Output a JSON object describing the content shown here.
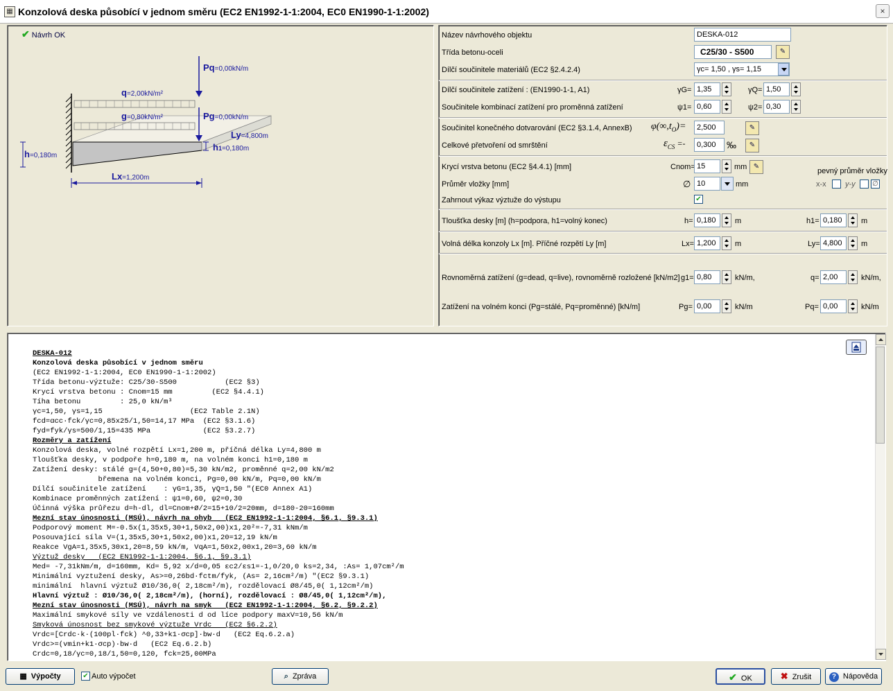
{
  "window": {
    "title": "Konzolová deska působící v jednom směru (EC2 EN1992-1-1:2004, EC0 EN1990-1-1:2002)",
    "close": "×"
  },
  "drawing": {
    "status": "Návrh OK",
    "pq_label": "Pq",
    "pq_value": "=0,00kN/m",
    "q_label": "q",
    "q_value": "=2,00kN/m²",
    "g_label": "g",
    "g_value": "=0,80kN/m²",
    "pg_label": "Pg",
    "pg_value": "=0,00kN/m",
    "ly_label": "Ly",
    "ly_value": "=4,800m",
    "h_label": "h",
    "h_value": "=0,180m",
    "h1_label": "h",
    "h1_sub": "1",
    "h1_value": "=0,180m",
    "lx_label": "Lx",
    "lx_value": "=1,200m"
  },
  "params": {
    "name_label": "Název návrhového objektu",
    "name_value": "DESKA-012",
    "class_label": "Třída betonu-oceli",
    "class_value": "C25/30 - S500",
    "mat_label": "Dílčí součinitele materiálů (EC2 §2.4.2.4)",
    "mat_value": "γc= 1,50 , γs= 1,15",
    "load_label": "Dílčí součinitele zatížení   : (EN1990-1-1, A1)",
    "gG_label": "γG=",
    "gG_value": "1,35",
    "gQ_label": "γQ=",
    "gQ_value": "1,50",
    "comb_label": "Součinitele kombinací zatížení pro proměnná zatížení",
    "psi1_label": "ψ1=",
    "psi1_value": "0,60",
    "psi2_label": "ψ2=",
    "psi2_value": "0,30",
    "creep_label": "Součinitel konečného dotvarování (EC2 §3.1.4, AnnexB)",
    "creep_sym": "φ(∞,t",
    "creep_sym_sub": "O",
    "creep_sym_end": ")=",
    "creep_value": "2,500",
    "shrink_label": "Celkové přetvoření od smrštění",
    "shrink_sym": "ε",
    "shrink_sym_sub": "CS",
    "shrink_sym_end": " =-",
    "shrink_value": "0,300",
    "shrink_unit": "‰",
    "cover_label": "Krycí vrstva betonu (EC2 §4.4.1) [mm]",
    "cnom_label": "Cnom=",
    "cnom_value": "15",
    "cnom_unit": "mm",
    "fixed_diam_label": "pevný průměr vložky",
    "diam_label": "Průměr vložky [mm]",
    "diam_sym": "∅",
    "diam_value": "10",
    "diam_unit": "mm",
    "xx_label": "x-x",
    "yy_label": "y-y",
    "include_label": "Zahrnout výkaz výztuže do výstupu",
    "thick_label": "Tloušťka desky [m] (h=podpora, h1=volný konec)",
    "h_label": "h=",
    "h_value": "0,180",
    "h_unit": "m",
    "h1_label": "h1=",
    "h1_value": "0,180",
    "h1_unit": "m",
    "span_label": "Volná délka konzoly Lx [m].   Příčné rozpětí Ly [m]",
    "lx_label": "Lx=",
    "lx_value": "1,200",
    "lx_unit": "m",
    "ly_label": "Ly=",
    "ly_value": "4,800",
    "ly_unit": "m",
    "udl_label": "Rovnoměrná zatížení (g=dead, q=live), rovnoměrně rozložené [kN/m2]",
    "g1_label": "g1=",
    "g1_value": "0,80",
    "g1_unit": "kN/m,",
    "q_label": "q=",
    "q_value": "2,00",
    "q_unit": "kN/m,",
    "end_label": "Zatížení na volném konci (Pg=stálé, Pq=proměnné) [kN/m]",
    "pg_label": "Pg=",
    "pg_value": "0,00",
    "pg_unit": "kN/m",
    "pq_label": "Pq=",
    "pq_value": "0,00",
    "pq_unit": "kN/m"
  },
  "report": {
    "lines": [
      {
        "t": "DESKA-012",
        "s": "bu"
      },
      {
        "t": "Konzolová deska působící v jednom směru",
        "s": "b"
      },
      {
        "t": "(EC2 EN1992-1-1:2004, EC0 EN1990-1-1:2002)",
        "s": ""
      },
      {
        "t": "Třída betonu-výztuže: C25/30-S500           (EC2 §3)",
        "s": ""
      },
      {
        "t": "Krycí vrstva betonu : Cnom=15 mm         (EC2 §4.4.1)",
        "s": ""
      },
      {
        "t": "Tíha betonu         : 25,0 kN/m³",
        "s": ""
      },
      {
        "t": "γc=1,50, γs=1,15                    (EC2 Table 2.1N)",
        "s": ""
      },
      {
        "t": "fcd=αcc·fck/γc=0,85x25/1,50=14,17 MPa  (EC2 §3.1.6)",
        "s": ""
      },
      {
        "t": "fyd=fyk/γs=500/1,15=435 MPa            (EC2 §3.2.7)",
        "s": ""
      },
      {
        "t": "Rozměry a zatížení",
        "s": "bu"
      },
      {
        "t": "Konzolová deska, volné rozpětí Lx=1,200 m, příčná délka Ly=4,800 m",
        "s": ""
      },
      {
        "t": "Tloušťka desky, v podpoře h=0,180 m, na volném konci h1=0,180 m",
        "s": ""
      },
      {
        "t": "Zatížení desky: stálé g=(4,50+0,80)=5,30 kN/m2, proměnné q=2,00 kN/m2",
        "s": ""
      },
      {
        "t": "               břemena na volném konci, Pg=0,00 kN/m, Pq=0,00 kN/m",
        "s": ""
      },
      {
        "t": "Dílčí součinitele zatížení    : γG=1,35, γQ=1,50 \"(EC0 Annex A1)",
        "s": ""
      },
      {
        "t": "Kombinace proměnných zatížení : ψ1=0,60, ψ2=0,30",
        "s": ""
      },
      {
        "t": "Účinná výška průřezu d=h-dl, dl=Cnom+Ø/2=15+10/2=20mm, d=180-20=160mm",
        "s": ""
      },
      {
        "t": "Mezní stav únosnosti (MSÚ), návrh na ohyb   (EC2 EN1992-1-1:2004, §6.1, §9.3.1)",
        "s": "bu"
      },
      {
        "t": "Podporový moment M=-0.5x(1,35x5,30+1,50x2,00)x1,20²=-7,31 kNm/m",
        "s": ""
      },
      {
        "t": "Posouvající síla V=(1,35x5,30+1,50x2,00)x1,20=12,19 kN/m",
        "s": ""
      },
      {
        "t": "Reakce VgA=1,35x5,30x1,20=8,59 kN/m, VqA=1,50x2,00x1,20=3,60 kN/m",
        "s": ""
      },
      {
        "t": "Výztuž desky   (EC2 EN1992-1-1:2004, §6.1, §9.3.1)",
        "s": "u"
      },
      {
        "t": "Med= -7,31kNm/m, d=160mm, Kd= 5,92 x/d=0,05 εc2/εs1=-1,0/20,0 ks=2,34, :As= 1,07cm²/m",
        "s": ""
      },
      {
        "t": "Minimální vyztužení desky, As>=0,26bd·fctm/fyk, (As= 2,16cm²/m) \"(EC2 §9.3.1)",
        "s": ""
      },
      {
        "t": "minimální  hlavní výztuž Ø10/36,0( 2,18cm²/m), rozdělovací Ø8/45,0( 1,12cm²/m)",
        "s": ""
      },
      {
        "t": "Hlavní výztuž : Ø10/36,0( 2,18cm²/m), (horní), rozdělovací : Ø8/45,0( 1,12cm²/m),",
        "s": "b"
      },
      {
        "t": "Mezní stav únosnosti (MSÚ), návrh na smyk   (EC2 EN1992-1-1:2004, §6.2, §9.2.2)",
        "s": "bu"
      },
      {
        "t": "Maximální smykové síly ve vzdálenosti d od líce podpory maxV=10,56 kN/m",
        "s": ""
      },
      {
        "t": "Smyková únosnost bez smykové výztuže Vrdc   (EC2 §6.2.2)",
        "s": "u"
      },
      {
        "t": "Vrdc=[Crdc·k·(100pl·fck) ^0,33+k1·σcp]·bw·d   (EC2 Eq.6.2.a)",
        "s": ""
      },
      {
        "t": "Vrdc>=(vmin+k1·σcp)·bw·d   (EC2 Eq.6.2.b)",
        "s": ""
      },
      {
        "t": "Crdc=0,18/γc=0,18/1,50=0,120, fck=25,00MPa",
        "s": ""
      }
    ]
  },
  "footer": {
    "calc_label": "Výpočty",
    "auto_label": "Auto výpočet",
    "report_label": "Zpráva",
    "ok_label": "OK",
    "cancel_label": "Zrušit",
    "help_label": "Nápověda"
  }
}
